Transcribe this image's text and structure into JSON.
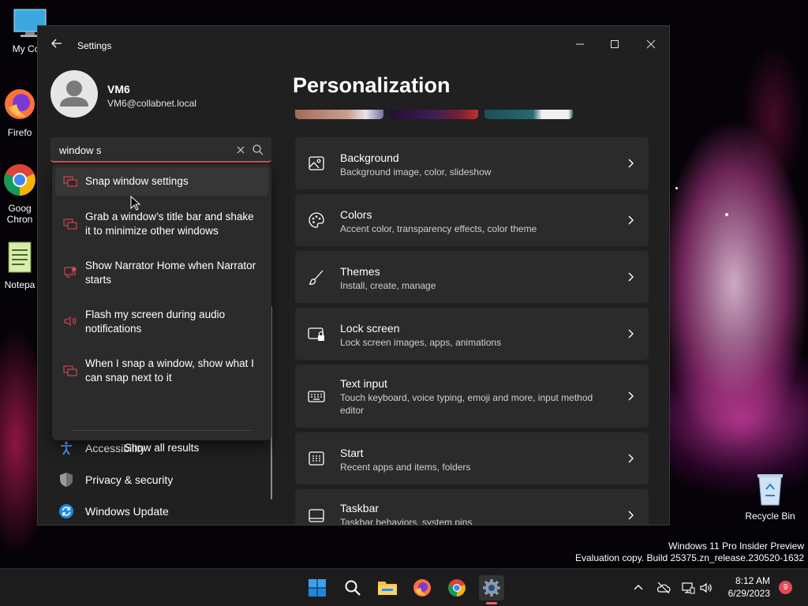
{
  "desktop": {
    "icons": [
      {
        "label": "My Com",
        "name": "this-pc"
      },
      {
        "label": "Firefo",
        "name": "firefox"
      },
      {
        "label": "Goog Chron",
        "name": "google-chrome"
      },
      {
        "label": "Notepa",
        "name": "notepad"
      },
      {
        "label": "Recycle Bin",
        "name": "recycle-bin"
      }
    ],
    "icons_split": {
      "chrome_line1": "Goog",
      "chrome_line2": "Chron"
    }
  },
  "window": {
    "title": "Settings",
    "controls": {
      "minimize": "minimize-icon",
      "maximize": "maximize-icon",
      "close": "close-icon"
    }
  },
  "profile": {
    "name": "VM6",
    "email": "VM6@collabnet.local"
  },
  "search": {
    "value": "window s",
    "suggestions": [
      "Snap window settings",
      "Grab a window’s title bar and shake it to minimize other windows",
      "Show Narrator Home when Narrator starts",
      "Flash my screen during audio notifications",
      "When I snap a window, show what I can snap next to it"
    ],
    "show_all": "Show all results"
  },
  "nav": {
    "items": [
      {
        "label": "Accessibility",
        "icon": "accessibility-icon"
      },
      {
        "label": "Privacy & security",
        "icon": "shield-icon"
      },
      {
        "label": "Windows Update",
        "icon": "windows-update-icon"
      }
    ]
  },
  "main": {
    "title": "Personalization",
    "cards": [
      {
        "title": "Background",
        "subtitle": "Background image, color, slideshow",
        "icon": "image-icon"
      },
      {
        "title": "Colors",
        "subtitle": "Accent color, transparency effects, color theme",
        "icon": "palette-icon"
      },
      {
        "title": "Themes",
        "subtitle": "Install, create, manage",
        "icon": "brush-icon"
      },
      {
        "title": "Lock screen",
        "subtitle": "Lock screen images, apps, animations",
        "icon": "lock-screen-icon"
      },
      {
        "title": "Text input",
        "subtitle": "Touch keyboard, voice typing, emoji and more, input method editor",
        "icon": "keyboard-icon"
      },
      {
        "title": "Start",
        "subtitle": "Recent apps and items, folders",
        "icon": "start-icon"
      },
      {
        "title": "Taskbar",
        "subtitle": "Taskbar behaviors, system pins",
        "icon": "taskbar-icon"
      }
    ]
  },
  "watermark": {
    "line1": "Windows 11 Pro Insider Preview",
    "line2": "Evaluation copy. Build 25375.zn_release.230520-1632"
  },
  "taskbar": {
    "time": "8:12 AM",
    "date": "6/29/2023",
    "notification_count": "9",
    "accent": "#e74856"
  }
}
